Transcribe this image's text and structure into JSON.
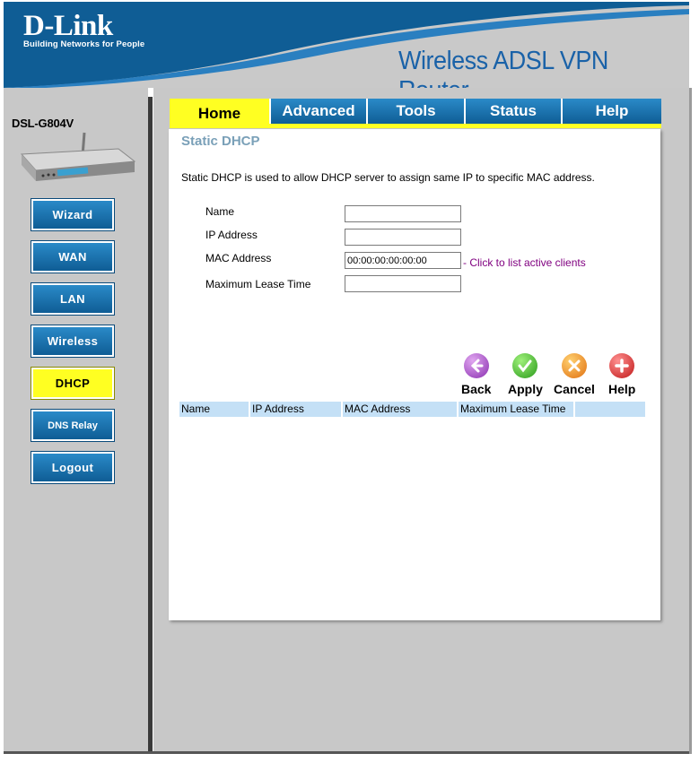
{
  "header": {
    "brand": "D-Link",
    "tagline": "Building Networks for People",
    "product_title": "Wireless ADSL VPN Router"
  },
  "sidebar": {
    "model": "DSL-G804V",
    "items": [
      {
        "label": "Wizard"
      },
      {
        "label": "WAN"
      },
      {
        "label": "LAN"
      },
      {
        "label": "Wireless"
      },
      {
        "label": "DHCP"
      },
      {
        "label": "DNS Relay"
      },
      {
        "label": "Logout"
      }
    ],
    "active": "DHCP"
  },
  "tabs": [
    {
      "label": "Home"
    },
    {
      "label": "Advanced"
    },
    {
      "label": "Tools"
    },
    {
      "label": "Status"
    },
    {
      "label": "Help"
    }
  ],
  "active_tab": "Home",
  "main": {
    "title": "Static DHCP",
    "description": "Static DHCP is used to allow DHCP server to assign same IP to specific MAC address.",
    "form": {
      "name_label": "Name",
      "name_value": "",
      "ip_label": "IP Address",
      "ip_value": "",
      "mac_label": "MAC Address",
      "mac_value": "00:00:00:00:00:00",
      "lease_label": "Maximum Lease Time",
      "lease_value": "",
      "client_link": "- Click to list active clients"
    },
    "actions": {
      "back": "Back",
      "apply": "Apply",
      "cancel": "Cancel",
      "help": "Help"
    },
    "table": {
      "columns": [
        "Name",
        "IP Address",
        "MAC Address",
        "Maximum Lease Time",
        ""
      ]
    }
  },
  "colors": {
    "accent_blue": "#1a62a8",
    "button_blue": "#0f5d95",
    "active_yellow": "#ffff22",
    "table_header": "#c4e0f6"
  }
}
